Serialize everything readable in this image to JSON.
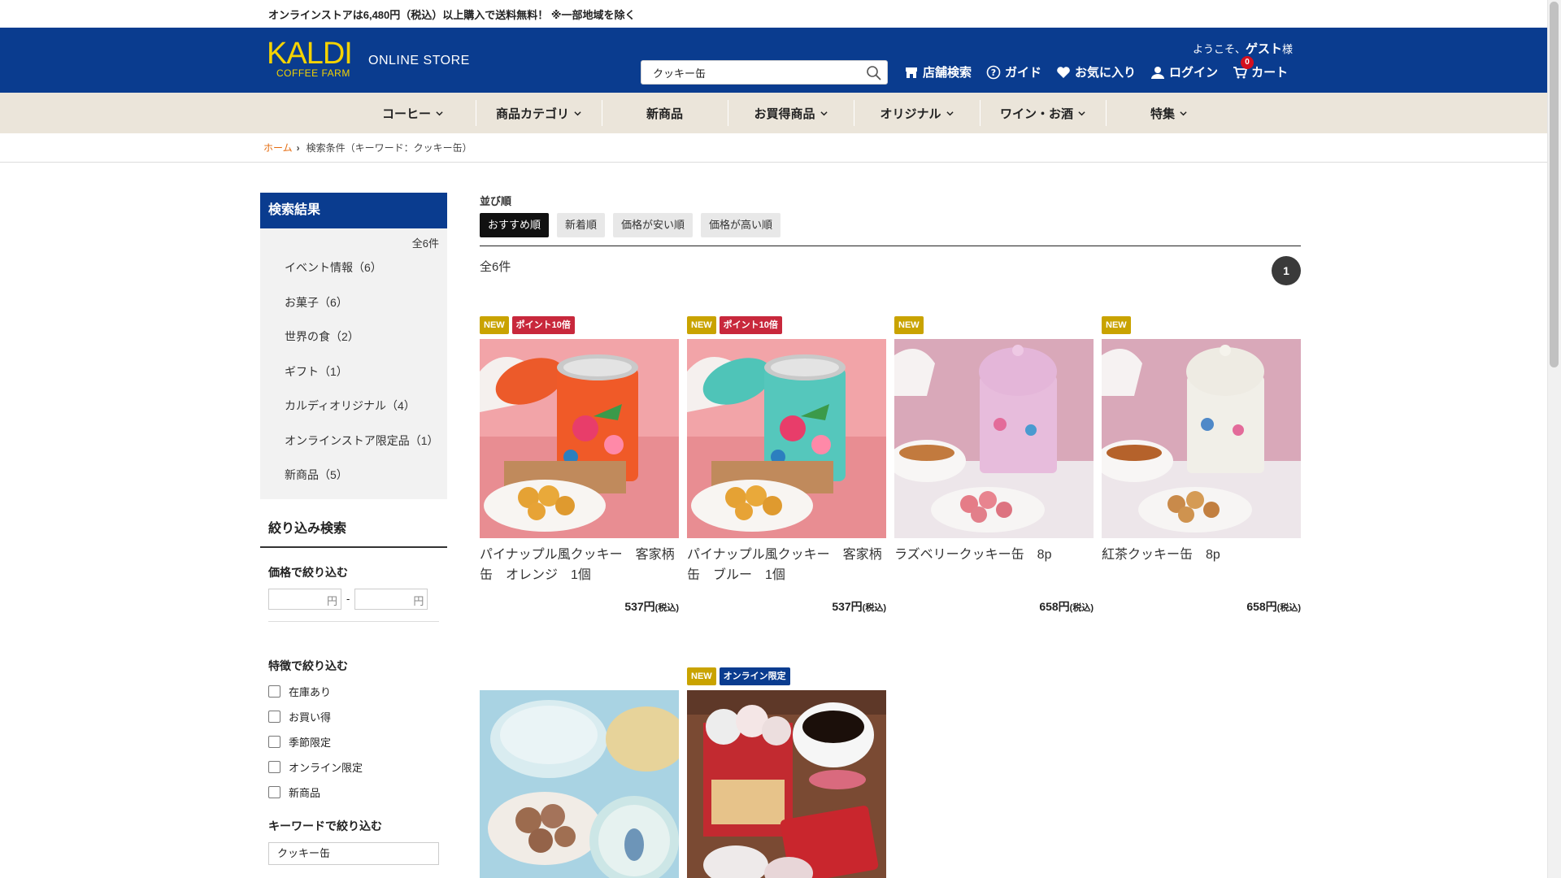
{
  "notice": "オンラインストアは6,480円（税込）以上購入で送料無料！ ※一部地域を除く",
  "header": {
    "logo_main": "KALDI",
    "logo_sub": "COFFEE FARM",
    "store_label": "ONLINE STORE",
    "search_value": "クッキー缶",
    "welcome_prefix": "ようこそ、",
    "welcome_name": "ゲスト",
    "welcome_suffix": "様",
    "nav": {
      "store": "店舗検索",
      "guide": "ガイド",
      "favorites": "お気に入り",
      "login": "ログイン",
      "cart": "カート",
      "cart_count": "0"
    },
    "brand_color": "#0a3c8f",
    "logo_color": "#f5d300"
  },
  "categories": [
    "コーヒー",
    "商品カテゴリ",
    "新商品",
    "お買得商品",
    "オリジナル",
    "ワイン・お酒",
    "特集"
  ],
  "breadcrumb": {
    "home": "ホーム",
    "current": "検索条件（キーワード：クッキー缶）"
  },
  "sidebar": {
    "title": "検索結果",
    "total": "全6件",
    "cats": [
      "イベント情報（6）",
      "お菓子（6）",
      "世界の食（2）",
      "ギフト（1）",
      "カルディオリジナル（4）",
      "オンラインストア限定品（1）",
      "新商品（5）"
    ],
    "filter_title": "絞り込み検索",
    "price_title": "価格で絞り込む",
    "yen": "円",
    "dash": "-",
    "feature_title": "特徴で絞り込む",
    "features": [
      "在庫あり",
      "お買い得",
      "季節限定",
      "オンライン限定",
      "新商品"
    ],
    "keyword_title": "キーワードで絞り込む",
    "keyword_value": "クッキー缶"
  },
  "main": {
    "sort_label": "並び順",
    "sorts": [
      "おすすめ順",
      "新着順",
      "価格が安い順",
      "価格が高い順"
    ],
    "count": "全6件",
    "page": "1"
  },
  "products": [
    {
      "badges": [
        "NEW",
        "ポイント10倍"
      ],
      "name": "パイナップル風クッキー　客家柄缶　オレンジ　1個",
      "price": "537円",
      "tax": "(税込)",
      "img": "orange-tin"
    },
    {
      "badges": [
        "NEW",
        "ポイント10倍"
      ],
      "name": "パイナップル風クッキー　客家柄缶　ブルー　1個",
      "price": "537円",
      "tax": "(税込)",
      "img": "blue-tin"
    },
    {
      "badges": [
        "NEW"
      ],
      "name": "ラズベリークッキー缶　8p",
      "price": "658円",
      "tax": "(税込)",
      "img": "pink-tin"
    },
    {
      "badges": [
        "NEW"
      ],
      "name": "紅茶クッキー缶　8p",
      "price": "658円",
      "tax": "(税込)",
      "img": "white-tin"
    },
    {
      "badges": [],
      "name": "",
      "price": "",
      "tax": "",
      "img": "rabbit-tins"
    },
    {
      "badges": [
        "NEW",
        "オンライン限定"
      ],
      "name": "",
      "price": "",
      "tax": "",
      "img": "amaretti-tin"
    }
  ]
}
